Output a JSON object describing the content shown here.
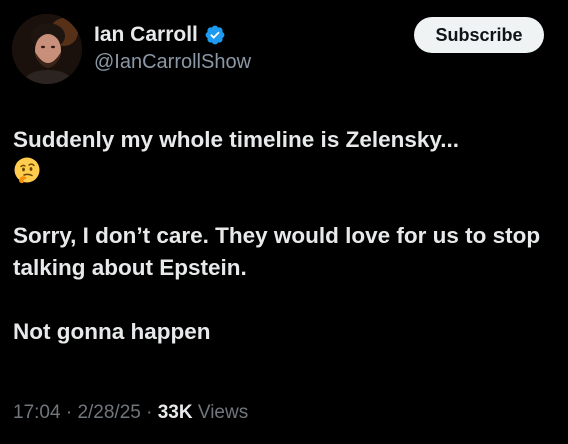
{
  "author": {
    "display_name": "Ian Carroll",
    "handle": "@IanCarrollShow",
    "verified": true,
    "avatar_icon": "profile-photo"
  },
  "actions": {
    "subscribe_label": "Subscribe"
  },
  "tweet": {
    "line1": "Suddenly my whole timeline is Zelensky...",
    "line1_emoji": "thinking-face-emoji",
    "line2": "Sorry, I don’t care. They would love for us to stop talking about Epstein.",
    "line3": "Not gonna happen"
  },
  "meta": {
    "time": "17:04",
    "separator": " · ",
    "date": "2/28/25",
    "views_count": "33K",
    "views_label": " Views"
  },
  "colors": {
    "background": "#000000",
    "text_primary": "#e7e9ea",
    "text_secondary": "#71767b",
    "verified_blue": "#1d9bf0",
    "button_bg": "#eff3f4"
  }
}
